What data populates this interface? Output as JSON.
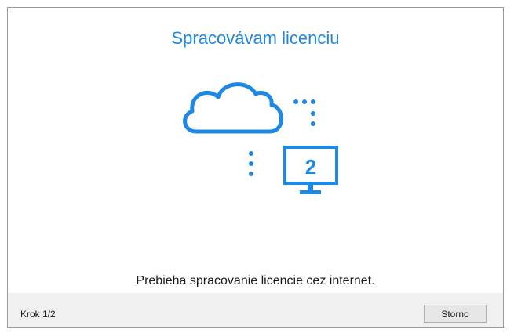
{
  "dialog": {
    "title": "Spracovávam licenciu",
    "monitor_number": "2",
    "message": "Prebieha spracovanie licencie cez internet."
  },
  "footer": {
    "step_label": "Krok 1/2",
    "cancel_label": "Storno"
  },
  "colors": {
    "accent": "#1e88e5"
  },
  "icons": [
    "cloud-icon",
    "monitor-icon"
  ]
}
